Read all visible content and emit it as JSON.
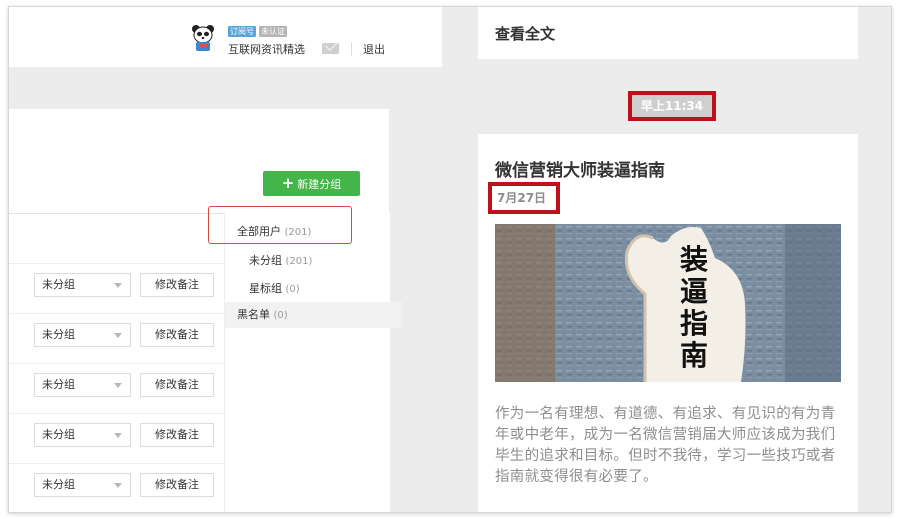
{
  "account": {
    "badge_subscription": "订阅号",
    "badge_unverified": "未认证",
    "name": "互联网资讯精选",
    "logout_label": "退出"
  },
  "toolbar": {
    "new_group_label": "新建分组"
  },
  "users": {
    "rows": [
      {
        "group": "未分组",
        "remark": "修改备注"
      },
      {
        "group": "未分组",
        "remark": "修改备注"
      },
      {
        "group": "未分组",
        "remark": "修改备注"
      },
      {
        "group": "未分组",
        "remark": "修改备注"
      },
      {
        "group": "未分组",
        "remark": "修改备注"
      }
    ]
  },
  "groups": {
    "all": {
      "label": "全部用户",
      "count": "(201)"
    },
    "ungrouped": {
      "label": "未分组",
      "count": "(201)"
    },
    "starred": {
      "label": "星标组",
      "count": "(0)"
    },
    "blacklist": {
      "label": "黑名单",
      "count": "(0)"
    }
  },
  "preview": {
    "read_all": "查看全文",
    "time": "早上11:34",
    "article": {
      "title": "微信营销大师装逼指南",
      "date": "7月27日",
      "image_text": [
        "装",
        "逼",
        "指",
        "南"
      ],
      "summary": "作为一名有理想、有道德、有追求、有见识的有为青年或中老年，成为一名微信营销届大师应该成为我们毕生的追求和目标。但时不我待，学习一些技巧或者指南就变得很有必要了。"
    }
  },
  "colors": {
    "primary_green": "#44b549",
    "highlight_red": "#b81419",
    "panel_grey": "#ececec"
  }
}
